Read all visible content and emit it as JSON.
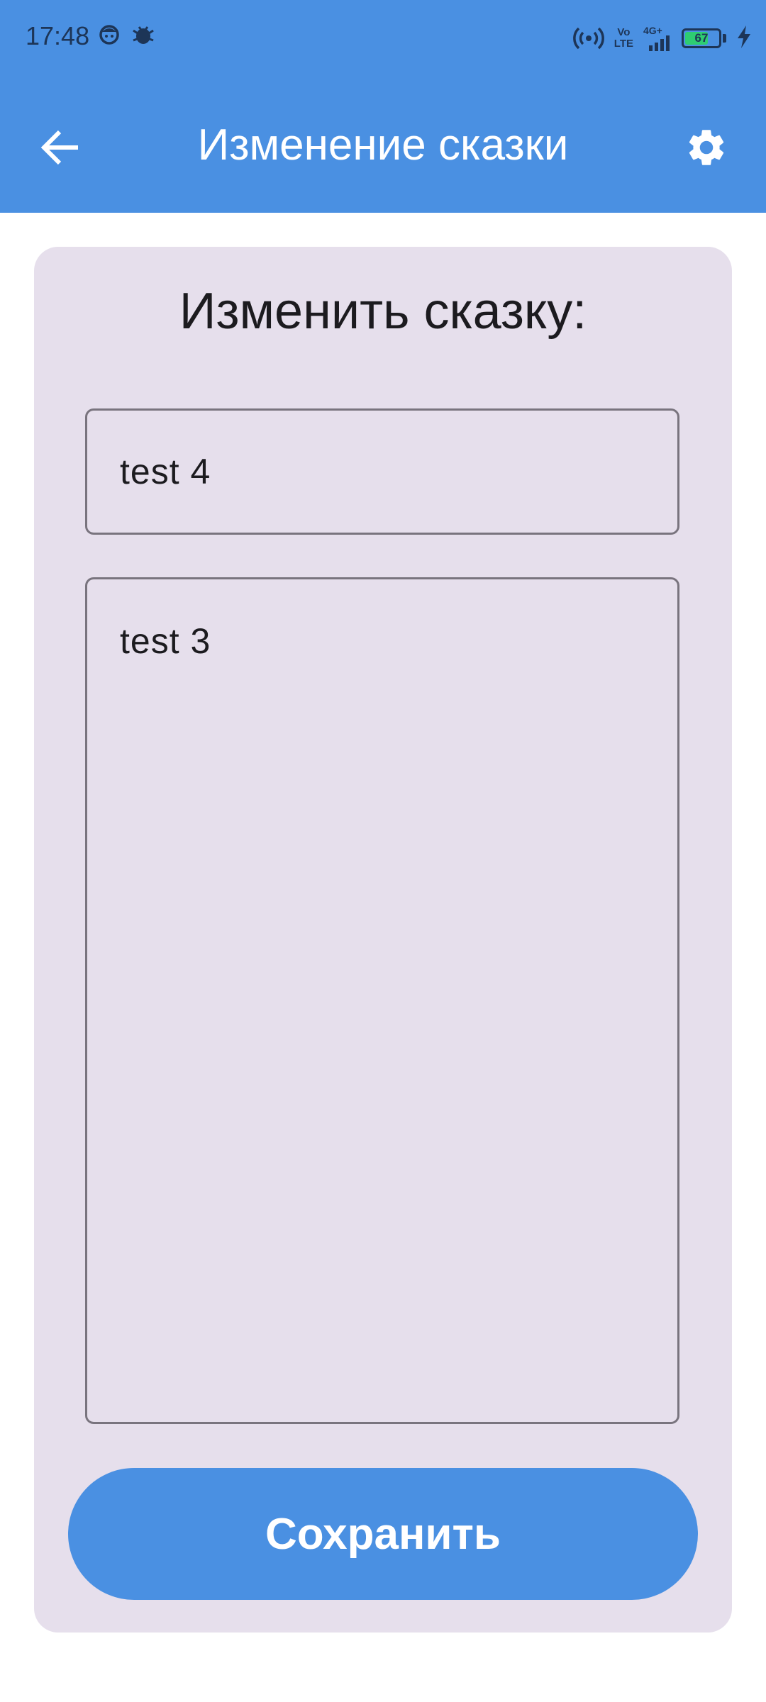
{
  "status_bar": {
    "time": "17:48",
    "vo_lte": "Vo\nLTE",
    "network": "4G+",
    "battery": "67"
  },
  "app_bar": {
    "title": "Изменение сказки",
    "back_icon": "arrow-back-icon",
    "settings_icon": "gear-icon",
    "color": "#4a90e2"
  },
  "form": {
    "heading": "Изменить сказку:",
    "title_value": "test 4",
    "body_value": "test 3",
    "save_label": "Сохранить",
    "card_color": "#e6dfec"
  }
}
